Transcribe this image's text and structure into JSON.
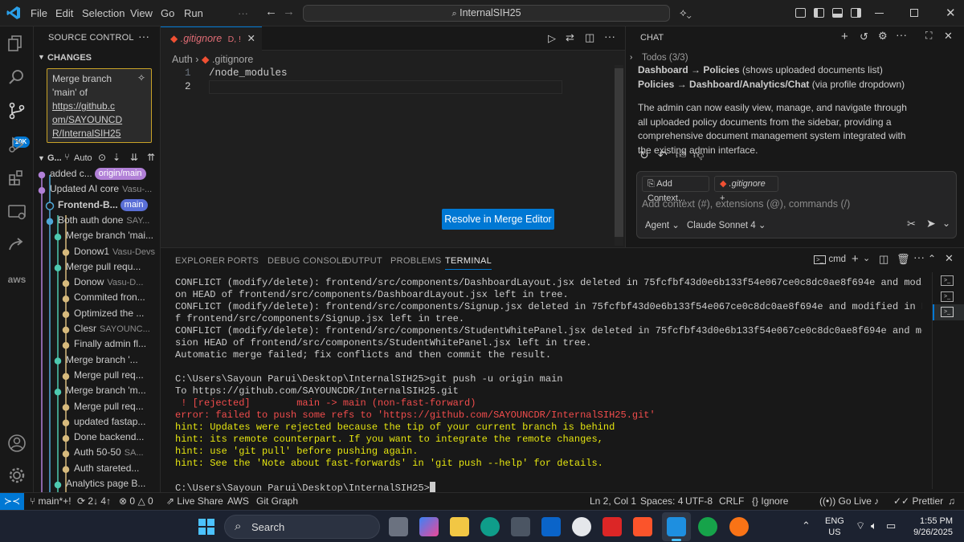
{
  "titlebar": {
    "menus": [
      "File",
      "Edit",
      "Selection",
      "View",
      "Go",
      "Run"
    ],
    "search_text": "InternalSIH25"
  },
  "activity": {
    "badge": "10K"
  },
  "sidebar": {
    "title": "SOURCE CONTROL",
    "changes_label": "CHANGES",
    "commit_message_lines": [
      "Merge branch",
      "'main' of",
      "https://github.c",
      "om/SAYOUNCD",
      "R/InternalSIH25"
    ],
    "graph_label": "G...",
    "auto_label": "Auto",
    "commits": [
      {
        "msg": "added c...",
        "author": "",
        "pill": "origin/main",
        "pill_color": "#b180d7"
      },
      {
        "msg": "Updated AI core",
        "author": "Vasu-...",
        "pill": "",
        "pill_color": ""
      },
      {
        "msg": "Frontend-B...",
        "author": "",
        "pill": "main",
        "pill_color": "#5a6fd6"
      },
      {
        "msg": "Both auth done",
        "author": "SAY...",
        "pill": "",
        "pill_color": ""
      },
      {
        "msg": "Merge branch 'mai...",
        "author": "",
        "pill": "",
        "pill_color": ""
      },
      {
        "msg": "Donow1",
        "author": "Vasu-Devs",
        "pill": "",
        "pill_color": ""
      },
      {
        "msg": "Merge pull requ...",
        "author": "",
        "pill": "",
        "pill_color": ""
      },
      {
        "msg": "Donow",
        "author": "Vasu-D...",
        "pill": "",
        "pill_color": ""
      },
      {
        "msg": "Commited fron...",
        "author": "",
        "pill": "",
        "pill_color": ""
      },
      {
        "msg": "Optimized the ...",
        "author": "",
        "pill": "",
        "pill_color": ""
      },
      {
        "msg": "Clesr",
        "author": "SAYOUNC...",
        "pill": "",
        "pill_color": ""
      },
      {
        "msg": "Finally admin fl...",
        "author": "",
        "pill": "",
        "pill_color": ""
      },
      {
        "msg": "Merge branch '...",
        "author": "",
        "pill": "",
        "pill_color": ""
      },
      {
        "msg": "Merge pull req...",
        "author": "",
        "pill": "",
        "pill_color": ""
      },
      {
        "msg": "Merge branch 'm...",
        "author": "",
        "pill": "",
        "pill_color": ""
      },
      {
        "msg": "Merge pull req...",
        "author": "",
        "pill": "",
        "pill_color": ""
      },
      {
        "msg": "updated fastap...",
        "author": "",
        "pill": "",
        "pill_color": ""
      },
      {
        "msg": "Done backend...",
        "author": "",
        "pill": "",
        "pill_color": ""
      },
      {
        "msg": "Auth 50-50",
        "author": "SA...",
        "pill": "",
        "pill_color": ""
      },
      {
        "msg": "Auth stareted...",
        "author": "",
        "pill": "",
        "pill_color": ""
      },
      {
        "msg": "Analytics page B...",
        "author": "",
        "pill": "",
        "pill_color": ""
      }
    ]
  },
  "editor": {
    "tab_name": ".gitignore",
    "tab_status": "D, !",
    "breadcrumb": [
      "Auth",
      ".gitignore"
    ],
    "lines": [
      "/node_modules",
      ""
    ],
    "line_numbers": [
      "1",
      "2"
    ],
    "resolve_button": "Resolve in Merge Editor"
  },
  "chat": {
    "title": "CHAT",
    "todos": "Todos (3/3)",
    "para1_bold1": "Dashboard",
    "para1_arrow": " → ",
    "para1_bold2": "Policies",
    "para1_text": " (shows uploaded documents list) ",
    "para1_bold3": "Policies → Dashboard/Analytics/Chat",
    "para1_tail": " (via profile dropdown)",
    "para2": "The admin can now easily view, manage, and navigate through all uploaded policy documents from the sidebar, providing a comprehensive document management system integrated with the existing admin interface.",
    "add_context": "Add Context...",
    "context_file": ".gitignore",
    "input_placeholder": "Add context (#), extensions (@), commands (/)",
    "agent_label": "Agent",
    "model_label": "Claude Sonnet 4"
  },
  "panel": {
    "tabs": [
      "EXPLORER",
      "PORTS",
      "DEBUG CONSOLE",
      "OUTPUT",
      "PROBLEMS",
      "TERMINAL"
    ],
    "active_tab": "TERMINAL",
    "shell": "cmd",
    "terminal_lines": [
      {
        "t": "CONFLICT (modify/delete): frontend/src/components/DashboardLayout.jsx deleted in 75fcfbf43d0e6b133f54e067ce0c8dc0ae8f694e and modified in HEAD.  Versi",
        "c": "#cccccc"
      },
      {
        "t": "on HEAD of frontend/src/components/DashboardLayout.jsx left in tree.",
        "c": "#cccccc"
      },
      {
        "t": "CONFLICT (modify/delete): frontend/src/components/Signup.jsx deleted in 75fcfbf43d0e6b133f54e067ce0c8dc0ae8f694e and modified in HEAD.  Version HEAD o",
        "c": "#cccccc"
      },
      {
        "t": "f frontend/src/components/Signup.jsx left in tree.",
        "c": "#cccccc"
      },
      {
        "t": "CONFLICT (modify/delete): frontend/src/components/StudentWhitePanel.jsx deleted in 75fcfbf43d0e6b133f54e067ce0c8dc0ae8f694e and modified in HEAD.  Ver",
        "c": "#cccccc"
      },
      {
        "t": "sion HEAD of frontend/src/components/StudentWhitePanel.jsx left in tree.",
        "c": "#cccccc"
      },
      {
        "t": "Automatic merge failed; fix conflicts and then commit the result.",
        "c": "#cccccc"
      },
      {
        "t": "",
        "c": "#cccccc"
      },
      {
        "t": "C:\\Users\\Sayoun Parui\\Desktop\\InternalSIH25>git push -u origin main",
        "c": "#cccccc"
      },
      {
        "t": "To https://github.com/SAYOUNCDR/InternalSIH25.git",
        "c": "#cccccc"
      },
      {
        "t": " ! [rejected]        main -> main (non-fast-forward)",
        "c": "#f14c4c"
      },
      {
        "t": "error: failed to push some refs to 'https://github.com/SAYOUNCDR/InternalSIH25.git'",
        "c": "#f14c4c"
      },
      {
        "t": "hint: Updates were rejected because the tip of your current branch is behind",
        "c": "#e5e510"
      },
      {
        "t": "hint: its remote counterpart. If you want to integrate the remote changes,",
        "c": "#e5e510"
      },
      {
        "t": "hint: use 'git pull' before pushing again.",
        "c": "#e5e510"
      },
      {
        "t": "hint: See the 'Note about fast-forwards' in 'git push --help' for details.",
        "c": "#e5e510"
      },
      {
        "t": "",
        "c": "#cccccc"
      },
      {
        "t": "C:\\Users\\Sayoun Parui\\Desktop\\InternalSIH25>",
        "c": "#cccccc"
      }
    ]
  },
  "statusbar": {
    "branch": "main*+!",
    "sync": "2↓ 4↑",
    "errors": "0",
    "warnings": "0",
    "live_share": "Live Share",
    "aws": "AWS",
    "git_graph": "Git Graph",
    "cursor": "Ln 2, Col 1",
    "spaces": "Spaces: 4",
    "encoding": "UTF-8",
    "eol": "CRLF",
    "language": "Ignore",
    "go_live": "Go Live",
    "prettier": "Prettier"
  },
  "taskbar": {
    "search": "Search",
    "lang1": "ENG",
    "lang2": "US",
    "time": "1:55 PM",
    "date": "9/26/2025"
  },
  "colors": {
    "accent": "#0078d4",
    "conflict": "#c9a227",
    "error": "#f14c4c",
    "hint": "#e5e510"
  }
}
